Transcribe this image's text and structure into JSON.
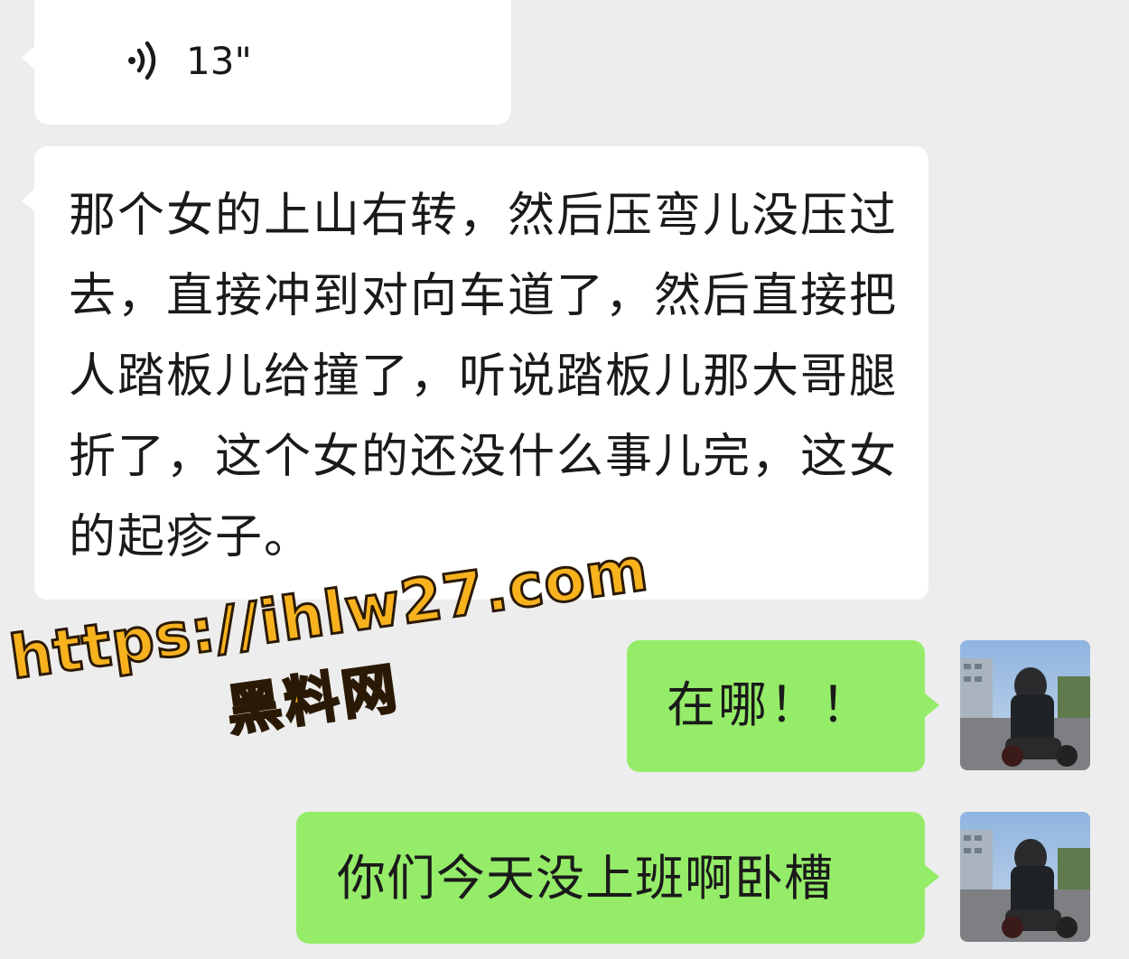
{
  "chat": {
    "messages": [
      {
        "type": "voice",
        "direction": "incoming",
        "duration": "13\""
      },
      {
        "type": "text",
        "direction": "incoming",
        "text": "那个女的上山右转，然后压弯儿没压过去，直接冲到对向车道了，然后直接把人踏板儿给撞了，听说踏板儿那大哥腿折了，这个女的还没什么事儿完，这女的起疹子。"
      },
      {
        "type": "text",
        "direction": "outgoing",
        "text": "在哪！！"
      },
      {
        "type": "text",
        "direction": "outgoing",
        "text": "你们今天没上班啊卧槽"
      }
    ]
  },
  "watermark": {
    "url": "https://ihlw27.com",
    "name": "黑料网"
  },
  "colors": {
    "background": "#ededed",
    "incoming_bubble": "#ffffff",
    "outgoing_bubble": "#95ec69",
    "watermark_fill": "#f7b21e",
    "watermark_stroke": "#2a1a05"
  },
  "icons": {
    "voice": "voice-wave-icon"
  }
}
